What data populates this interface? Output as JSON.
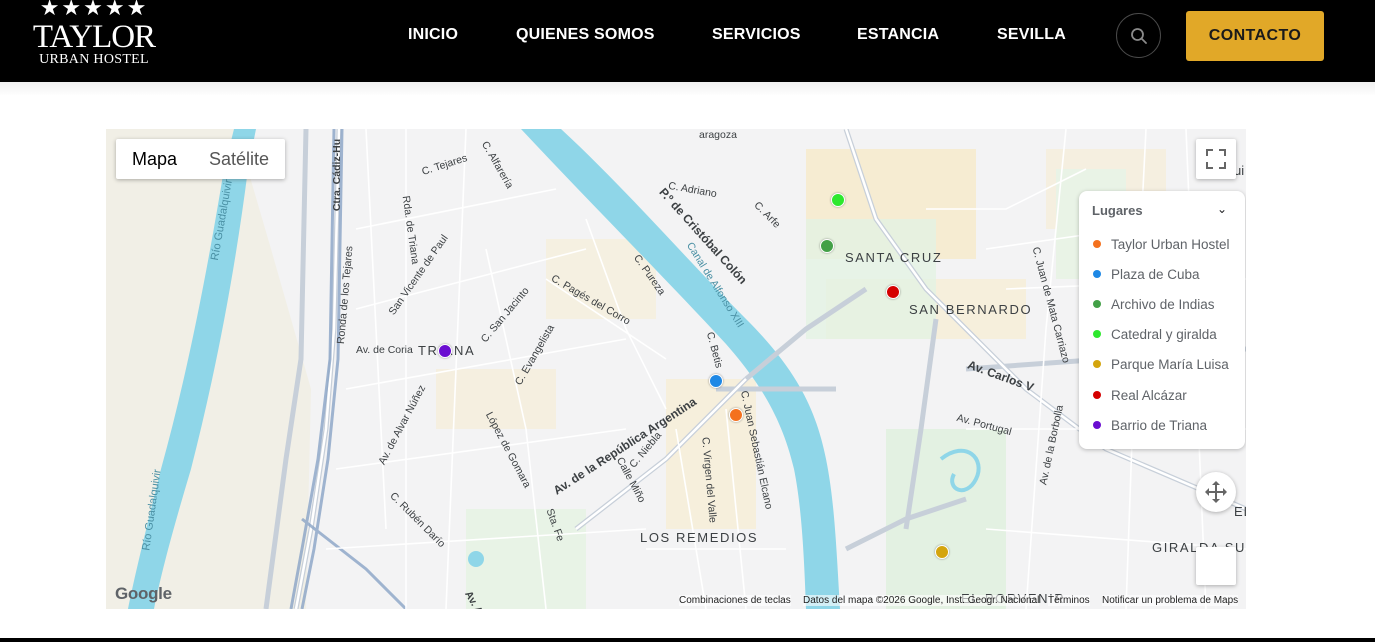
{
  "header": {
    "stars": "★★★★★",
    "logo_name": "TAYLOR",
    "logo_sub": "URBAN HOSTEL",
    "nav": [
      "INICIO",
      "QUIENES SOMOS",
      "SERVICIOS",
      "ESTANCIA",
      "SEVILLA"
    ],
    "search_icon": "search-icon",
    "contact_label": "CONTACTO",
    "accent_color": "#e1a828"
  },
  "map": {
    "map_type": [
      "Mapa",
      "Satélite"
    ],
    "legend": {
      "title": "Lugares",
      "items": [
        {
          "label": "Taylor Urban Hostel",
          "color": "#f4711e"
        },
        {
          "label": "Plaza de Cuba",
          "color": "#1e88e5"
        },
        {
          "label": "Archivo de Indias",
          "color": "#43a047"
        },
        {
          "label": "Catedral y giralda",
          "color": "#2ee82e"
        },
        {
          "label": "Parque María Luisa",
          "color": "#d4a50e"
        },
        {
          "label": "Real Alcázar",
          "color": "#d50000"
        },
        {
          "label": "Barrio de Triana",
          "color": "#6a0dd1"
        }
      ]
    },
    "districts": [
      "SANTA CRUZ",
      "SAN BERNARDO",
      "TRIANA",
      "LOS REMEDIOS",
      "GIRALDA SUR",
      "EL PORVENIR"
    ],
    "streets": [
      "C. Tejares",
      "C. Alfarería",
      "Ctra. Cádiz-Hu",
      "Rda. de Triana",
      "San Vicente de Paul",
      "Ronda de los Tejares",
      "C. San Jacinto",
      "C. Pagés del Corro",
      "C. Pureza",
      "C. Evangelista",
      "Av. de Coria",
      "Av. de Alvar Núñez",
      "López de Gomara",
      "C. Rubén Darío",
      "Av. de la República Argentina",
      "C. Niebla",
      "Calle Miño",
      "Sta. Fe",
      "C. Virgen del Valle",
      "C. Juan Sebastián Elcano",
      "C. Betis",
      "Canal de Alfonso XIII",
      "P.º de Cristóbal Colón",
      "C. Adriano",
      "C. Arfe",
      "C. Juan de Mata Carriazo",
      "Av. Carlos V",
      "Av. Portugal",
      "Av. de la Borbolla",
      "Río Guadalquivir",
      "Río Guadalquivir",
      "aragoza",
      "Av. A",
      "EL",
      "ui"
    ],
    "google": "Google",
    "attribution": [
      "Combinaciones de teclas",
      "Datos del mapa ©2026 Google, Inst. Geogr. Nacional",
      "Términos",
      "Notificar un problema de Maps"
    ],
    "icons": [
      "fullscreen-icon",
      "camera-control-icon"
    ]
  }
}
